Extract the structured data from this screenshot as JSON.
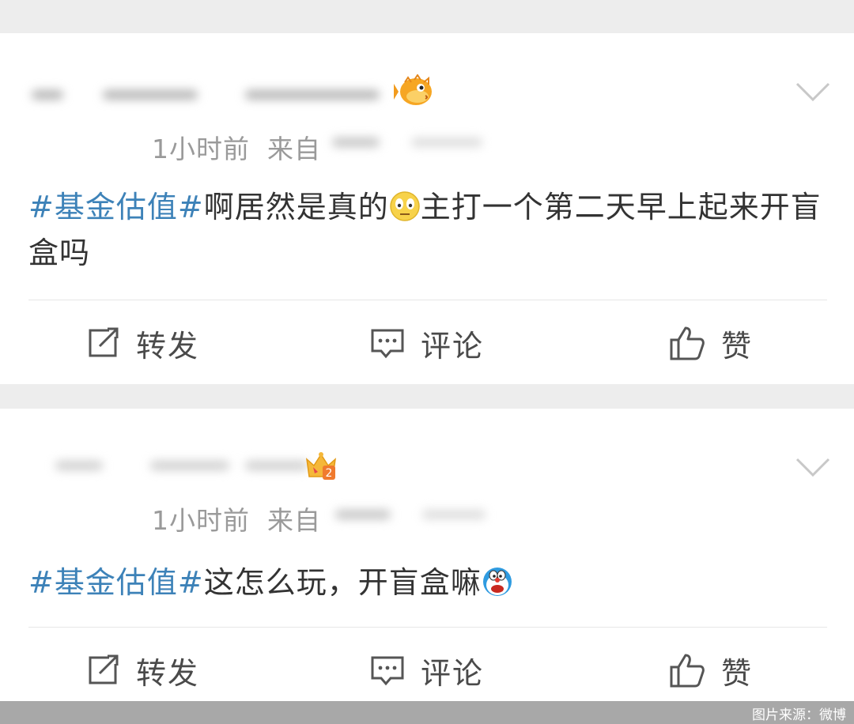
{
  "posts": [
    {
      "time": "1小时前",
      "source_prefix": "来自",
      "topic": "#基金估值#",
      "text_1": "啊居然是真的",
      "text_2": "主打一个第二天早上起来开盲盒吗",
      "badge_icon": "pufferfish-badge-icon",
      "emoji": "grimace-emoji-icon",
      "actions": {
        "repost": "转发",
        "comment": "评论",
        "like": "赞"
      }
    },
    {
      "time": "1小时前",
      "source_prefix": "来自",
      "topic": "#基金估值#",
      "text_1": "这怎么玩，开盲盒嘛",
      "badge_icon": "crown-level-2-badge-icon",
      "emoji": "doraemon-emoji-icon",
      "actions": {
        "repost": "转发",
        "comment": "评论",
        "like": "赞"
      }
    }
  ],
  "footer": {
    "credit": "图片来源：微博"
  },
  "colors": {
    "topic": "#3d82b8",
    "meta": "#9a9a9a",
    "text": "#333333",
    "background": "#ededed"
  }
}
